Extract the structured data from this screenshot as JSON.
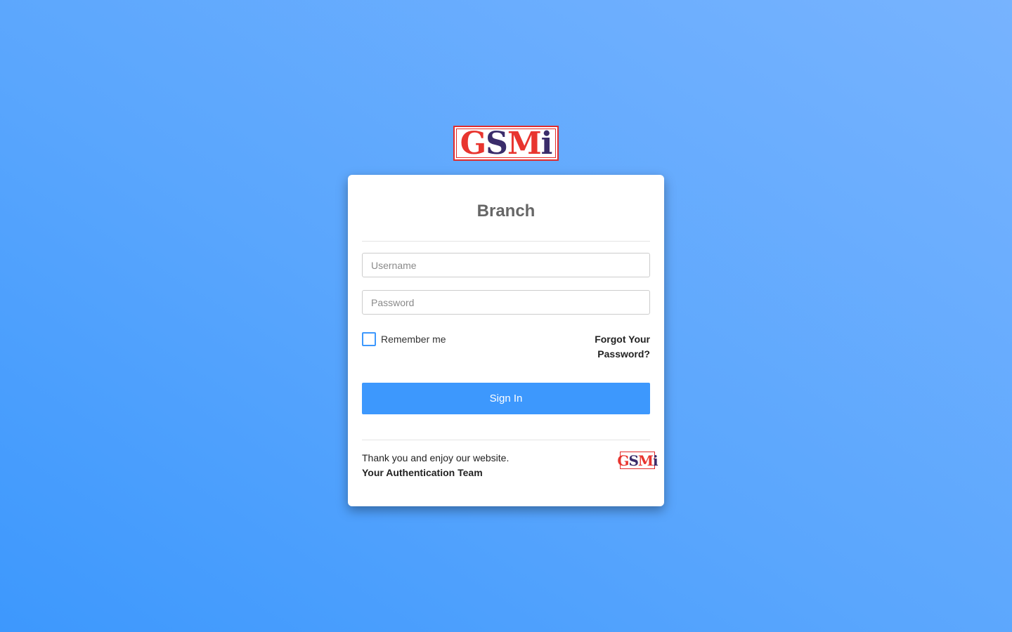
{
  "logo": {
    "letters": [
      "G",
      "S",
      "M",
      "i"
    ],
    "colors": {
      "red": "#e8352f",
      "navy": "#3a2c6a"
    }
  },
  "card": {
    "title": "Branch"
  },
  "form": {
    "username_placeholder": "Username",
    "password_placeholder": "Password",
    "remember_label": "Remember me",
    "remember_checked": false,
    "forgot_label": "Forgot Your Password?",
    "signin_label": "Sign In"
  },
  "footer": {
    "message": "Thank you and enjoy our website.",
    "team": "Your Authentication Team"
  },
  "colors": {
    "accent": "#3d98fd",
    "background_start": "#3d98fd",
    "background_end": "#77b3fe",
    "title": "#666666"
  },
  "icons": {
    "top_logo": "gsmi-logo",
    "footer_logo": "gsmi-logo-small"
  }
}
